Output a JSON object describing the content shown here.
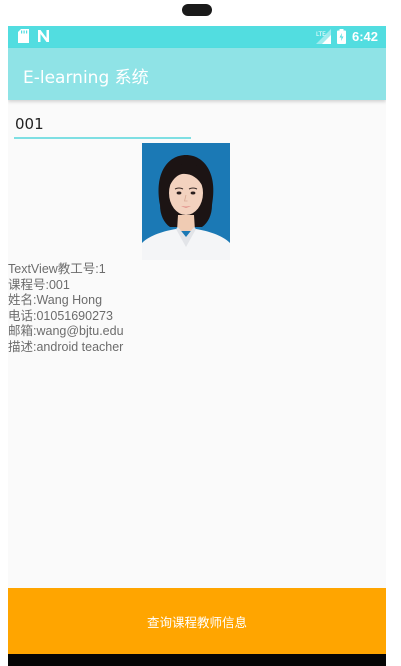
{
  "status_bar": {
    "time": "6:42",
    "icons": [
      "sd-card-icon",
      "n-notification-icon",
      "signal-icon",
      "battery-icon"
    ]
  },
  "app_bar": {
    "title": "E-learning 系统"
  },
  "form": {
    "course_input_value": "001"
  },
  "photo": {
    "alt": "teacher photo"
  },
  "teacher_info": [
    "TextView教工号:1",
    "课程号:001",
    "姓名:Wang Hong",
    "电话:01051690273",
    "邮箱:wang@bjtu.edu",
    "描述:android teacher"
  ],
  "actions": {
    "query_label": "查询课程教师信息"
  },
  "colors": {
    "status_bar": "#52dde0",
    "app_bar": "#8fe3e6",
    "input_underline": "#7edfe3",
    "button": "#ffa500",
    "photo_background": "#1b79b5"
  }
}
